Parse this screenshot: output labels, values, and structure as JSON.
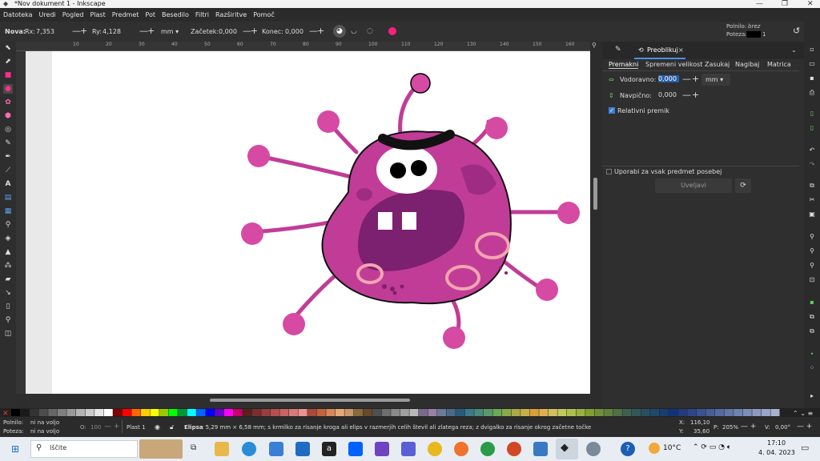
{
  "window": {
    "title": "*Nov dokument 1 - Inkscape"
  },
  "menu": [
    "Datoteka",
    "Uredi",
    "Pogled",
    "Plast",
    "Predmet",
    "Pot",
    "Besedilo",
    "Filtri",
    "Razširitve",
    "Pomoč"
  ],
  "toolctrl": {
    "label": "Nova:",
    "rx_label": "Rx:",
    "rx_value": "7,353",
    "ry_label": "Ry:",
    "ry_value": "4,128",
    "unit": "mm",
    "start_label": "Začetek:",
    "start_value": "0,000",
    "end_label": "Konec:",
    "end_value": "0,000",
    "fill_label": "Polnilo:",
    "fill_value": "brez",
    "stroke_label": "Poteza:",
    "stroke_value": "1"
  },
  "ruler": {
    "ticks": [
      "10",
      "20",
      "30",
      "40",
      "50",
      "60",
      "70",
      "80",
      "90",
      "100",
      "110",
      "120",
      "130",
      "140",
      "150",
      "160"
    ]
  },
  "panel": {
    "tab_label": "Preoblikuj",
    "subtabs": [
      "Premakni",
      "Spremeni velikost",
      "Zasukaj",
      "Nagibaj",
      "Matrica"
    ],
    "horizontal_label": "Vodoravno:",
    "horizontal_value": "0,000",
    "vertical_label": "Navpično:",
    "vertical_value": "0,000",
    "unit": "mm",
    "relative_label": "Relativni premik",
    "separately_label": "Uporabi za vsak predmet posebej",
    "apply_label": "Uveljavi"
  },
  "status": {
    "fill_label": "Polnilo:",
    "fill_value": "ni na voljo",
    "stroke_label": "Poteza:",
    "stroke_value": "ni na voljo",
    "opacity_label": "O:",
    "opacity_value": "100",
    "layer": "Plast 1",
    "message_bold": "Elipsa",
    "message": ": 5,29 mm × 6,58 mm; s krmilko za risanje kroga ali elips v razmerjih celih števil ali zlatega reza; z dvigalko za risanje okrog začetne točke",
    "x_label": "X:",
    "x_value": "116,10",
    "y_label": "Y:",
    "y_value": "35,60",
    "zoom_label": "P:",
    "zoom_value": "205%",
    "rot_label": "V:",
    "rot_value": "0,00°"
  },
  "taskbar": {
    "search": "Iščite",
    "temp": "10°C",
    "time": "17:10",
    "date": "4. 04. 2023"
  },
  "colors": {
    "accent": "#ff1f7a",
    "monster": "#c13c97",
    "monster_dark": "#7c2070"
  }
}
